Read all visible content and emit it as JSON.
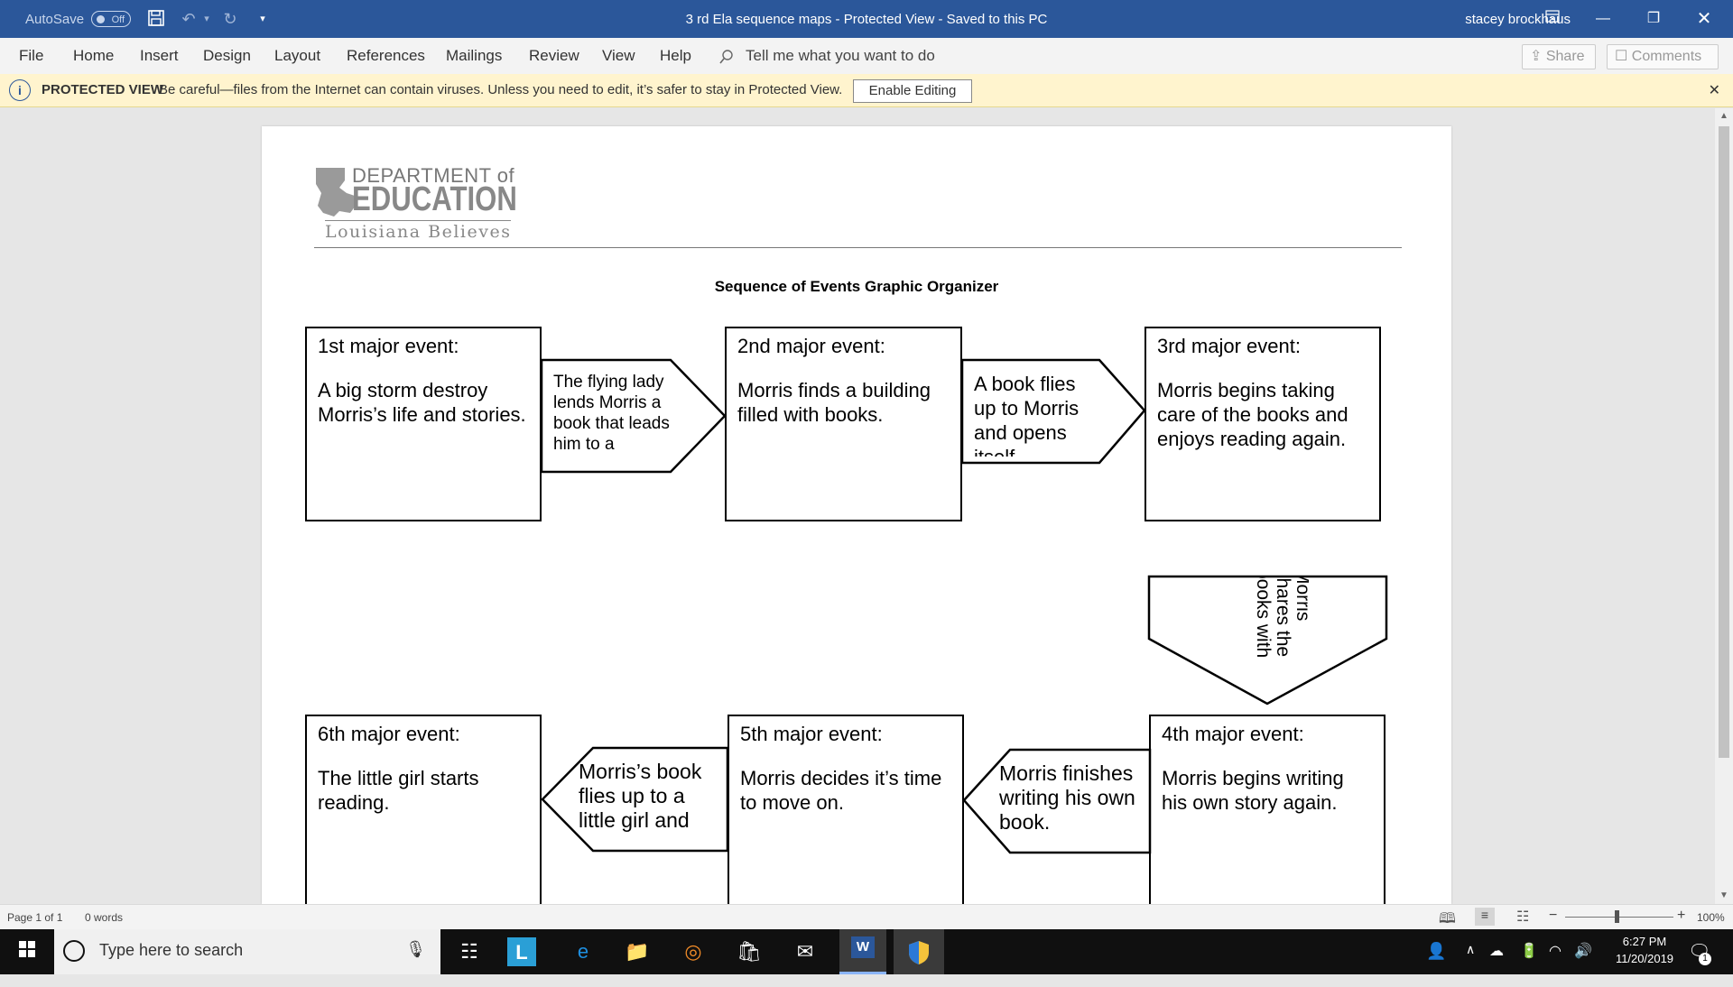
{
  "titlebar": {
    "autosave_label": "AutoSave",
    "autosave_state": "Off",
    "doc_title": "3 rd Ela sequence maps  -  Protected View  -  Saved to this PC",
    "user": "stacey brockhaus"
  },
  "menu": {
    "items": [
      "File",
      "Home",
      "Insert",
      "Design",
      "Layout",
      "References",
      "Mailings",
      "Review",
      "View",
      "Help"
    ],
    "tell_me": "Tell me what you want to do",
    "share": "Share",
    "comments": "Comments"
  },
  "protected": {
    "title": "PROTECTED VIEW",
    "message": "Be careful—files from the Internet can contain viruses. Unless you need to edit, it’s safer to stay in Protected View.",
    "button": "Enable Editing"
  },
  "document": {
    "logo": {
      "line1": "DEPARTMENT of",
      "line2": "EDUCATION",
      "line3": "Louisiana Believes"
    },
    "heading": "Sequence of Events Graphic Organizer",
    "events": [
      {
        "label": "1st major event:",
        "text": "A big storm destroy Morris’s life and stories."
      },
      {
        "label": "2nd major event:",
        "text": "Morris finds a building filled with books."
      },
      {
        "label": "3rd major event:",
        "text": "Morris begins taking care of the books and enjoys reading again."
      },
      {
        "label": "4th major event:",
        "text": "Morris begins writing his own story again."
      },
      {
        "label": "5th major event:",
        "text": "Morris decides it’s time to move on."
      },
      {
        "label": "6th major event:",
        "text": "The little girl starts reading."
      }
    ],
    "transitions": [
      "The flying lady lends Morris a book that leads him to a",
      "A book flies up to Morris and opens itself",
      "Morris shares the books with the townspeople.",
      "Morris finishes writing his own book.",
      "Morris’s book flies up to a little girl and"
    ]
  },
  "status": {
    "page": "Page 1 of 1",
    "words": "0 words",
    "zoom": "100%"
  },
  "taskbar": {
    "search_placeholder": "Type here to search",
    "time": "6:27 PM",
    "date": "11/20/2019",
    "notification_count": "1"
  }
}
